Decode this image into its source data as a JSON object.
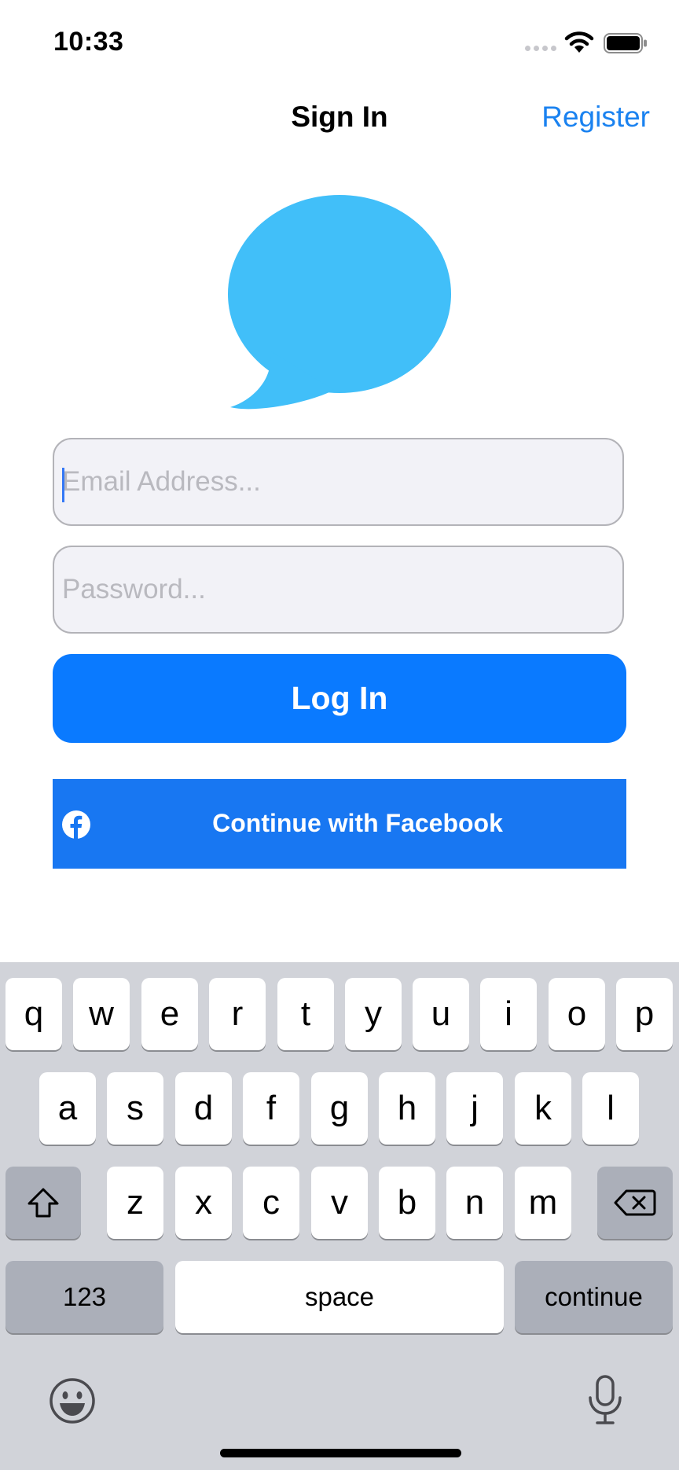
{
  "status_bar": {
    "time": "10:33"
  },
  "nav": {
    "title": "Sign In",
    "register_label": "Register"
  },
  "form": {
    "email_placeholder": "Email Address...",
    "password_placeholder": "Password...",
    "login_label": "Log In",
    "facebook_label": "Continue with Facebook"
  },
  "colors": {
    "accent": "#0a7aff",
    "facebook": "#1877f2",
    "logo": "#41bff9",
    "field_bg": "#f2f2f7",
    "keyboard_bg": "#d1d3d9"
  },
  "icons": [
    "signal-icon",
    "wifi-icon",
    "battery-icon",
    "chat-bubble-logo",
    "facebook-icon",
    "shift-icon",
    "backspace-icon",
    "emoji-icon",
    "microphone-icon"
  ],
  "keyboard": {
    "row1": [
      "q",
      "w",
      "e",
      "r",
      "t",
      "y",
      "u",
      "i",
      "o",
      "p"
    ],
    "row2": [
      "a",
      "s",
      "d",
      "f",
      "g",
      "h",
      "j",
      "k",
      "l"
    ],
    "row3": [
      "z",
      "x",
      "c",
      "v",
      "b",
      "n",
      "m"
    ],
    "numbers_label": "123",
    "space_label": "space",
    "return_label": "continue"
  }
}
